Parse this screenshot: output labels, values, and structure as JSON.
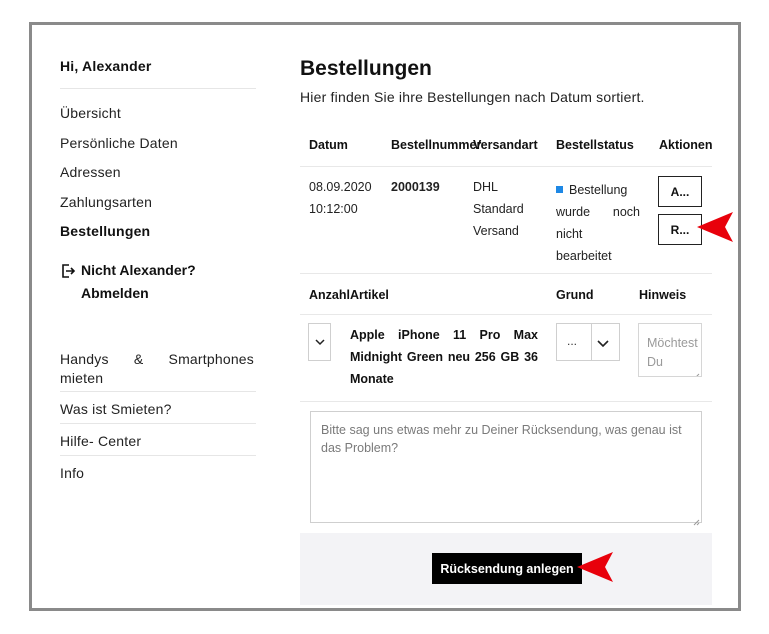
{
  "sidebar": {
    "greeting": "Hi, Alexander",
    "items": [
      {
        "label": "Übersicht"
      },
      {
        "label": "Persönliche Daten"
      },
      {
        "label": "Adressen"
      },
      {
        "label": "Zahlungsarten"
      },
      {
        "label": "Bestellungen"
      }
    ],
    "logout_line1": "Nicht Alexander?",
    "logout_line2": "Abmelden",
    "secondary": [
      {
        "label": "Handys & Smartphones mieten"
      },
      {
        "label": "Was ist Smieten?"
      },
      {
        "label": "Hilfe- Center"
      },
      {
        "label": "Info"
      }
    ]
  },
  "main": {
    "title": "Bestellungen",
    "subtitle": "Hier finden Sie ihre Bestellungen nach Datum sortiert.",
    "orders_table": {
      "headers": [
        "Datum",
        "Bestellnummer",
        "Versandart",
        "Bestellstatus",
        "Aktionen"
      ],
      "row": {
        "date": "08.09.2020",
        "time": "10:12:00",
        "order_number": "2000139",
        "shipping": "DHL Standard Versand",
        "status": "Bestellung wurde noch nicht bearbeitet",
        "status_color": "#1e88e5",
        "action1": "A...",
        "action2": "R..."
      }
    },
    "return_table": {
      "headers": [
        "Anzahl",
        "Artikel",
        "Grund",
        "Hinweis"
      ],
      "article": "Apple iPhone 11 Pro Max Midnight Green neu 256 GB 36 Monate",
      "reason_value": "...",
      "hint_placeholder": "Möchtest Du uns..."
    },
    "comment_placeholder": "Bitte sag uns etwas mehr zu Deiner Rücksendung, was genau ist das Problem?",
    "submit_label": "Rücksendung anlegen"
  },
  "colors": {
    "accent_arrow": "#e8000b",
    "frame_border": "#8a8a8a",
    "footer_bg": "#f3f3f6"
  }
}
